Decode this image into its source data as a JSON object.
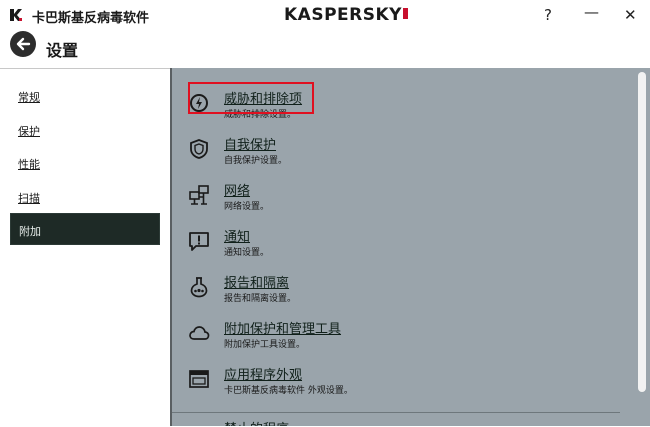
{
  "window": {
    "app_title": "卡巴斯基反病毒软件",
    "brand": "KASPERSKY",
    "help": "?",
    "minimize": "—",
    "close": "✕"
  },
  "header": {
    "title": "设置"
  },
  "sidebar": {
    "items": [
      {
        "label": "常规"
      },
      {
        "label": "保护"
      },
      {
        "label": "性能"
      },
      {
        "label": "扫描"
      },
      {
        "label": "附加"
      }
    ]
  },
  "main": {
    "items": [
      {
        "title": "威胁和排除项",
        "desc": "威胁和排除设置。"
      },
      {
        "title": "自我保护",
        "desc": "自我保护设置。"
      },
      {
        "title": "网络",
        "desc": "网络设置。"
      },
      {
        "title": "通知",
        "desc": "通知设置。"
      },
      {
        "title": "报告和隔离",
        "desc": "报告和隔离设置。"
      },
      {
        "title": "附加保护和管理工具",
        "desc": "附加保护工具设置。"
      },
      {
        "title": "应用程序外观",
        "desc": "卡巴斯基反病毒软件 外观设置。"
      }
    ],
    "cut_off_title": "禁止的程序"
  },
  "colors": {
    "accent_red": "#e01020",
    "sidebar_active": "#1e2a26",
    "content_bg": "#9aa4ab"
  }
}
